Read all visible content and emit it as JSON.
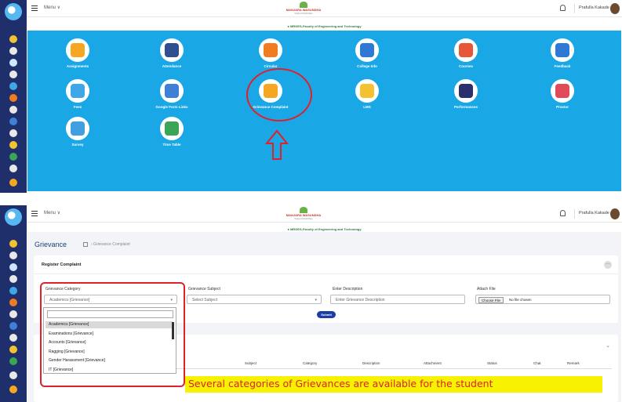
{
  "colors": {
    "sidebar": "#1f2f6b",
    "tiles_bg": "#1aa7e6",
    "highlight": "#e0202a",
    "callout_bg": "#f6f200",
    "submit": "#1f3fa0"
  },
  "topbar": {
    "menu_label": "Menu ∨",
    "brand_name": "MANJARA WASUNDHA",
    "brand_sub": "Vidya Pratishthan",
    "user_name": "Prafulla Kakade",
    "faculty": "● MRGES-Faculty of Engineering and Technology"
  },
  "tiles": [
    {
      "label": "Assignments",
      "icon": "assignments-icon",
      "color": "#f5a623"
    },
    {
      "label": "Attendance",
      "icon": "attendance-icon",
      "color": "#2f4f8f"
    },
    {
      "label": "Circular",
      "icon": "circular-icon",
      "color": "#f07b21"
    },
    {
      "label": "College Info",
      "icon": "college-info-icon",
      "color": "#2f78d6"
    },
    {
      "label": "Courses",
      "icon": "courses-icon",
      "color": "#e8563a"
    },
    {
      "label": "Feedback",
      "icon": "feedback-icon",
      "color": "#2f78d6"
    },
    {
      "label": "Fees",
      "icon": "fees-icon",
      "color": "#3fa7e8"
    },
    {
      "label": "Google Form Links",
      "icon": "google-form-icon",
      "color": "#3f7fd6"
    },
    {
      "label": "Grievance Complaint",
      "icon": "grievance-icon",
      "color": "#f5a623"
    },
    {
      "label": "LMS",
      "icon": "lms-icon",
      "color": "#f2c230"
    },
    {
      "label": "Performances",
      "icon": "performances-icon",
      "color": "#2b2f6b"
    },
    {
      "label": "Proctor",
      "icon": "proctor-icon",
      "color": "#e04b5a"
    },
    {
      "label": "Survey",
      "icon": "survey-icon",
      "color": "#3f9fe0"
    },
    {
      "label": "Time Table",
      "icon": "time-table-icon",
      "color": "#3aa655"
    }
  ],
  "grievance": {
    "page_title": "Grievance",
    "breadcrumb": "› Grievance Complaint",
    "card_title": "Register Complaint",
    "more": "···",
    "fields": {
      "category_label": "Grievance Category",
      "category_value": "Academics [Grievance]",
      "subject_label": "Grievance Subject",
      "subject_placeholder": "Select Subject",
      "description_label": "Enter Description",
      "description_placeholder": "Enter Grievance Description",
      "attach_label": "Attach File",
      "choose_file": "Choose File",
      "no_file": "No file chosen"
    },
    "submit": "Submit",
    "dropdown_options": [
      "Academics [Grievance]",
      "Examinations [Grievance]",
      "Accounts [Grievance]",
      "Ragging [Grievance]",
      "Gender Harassment [Grievance]",
      "IT [Grievance]"
    ],
    "table_headers": [
      "Subject",
      "Category",
      "Description",
      "Attachment",
      "Status",
      "Chat",
      "Remark"
    ]
  },
  "callout": "Several categories of Grievances are available for the student"
}
